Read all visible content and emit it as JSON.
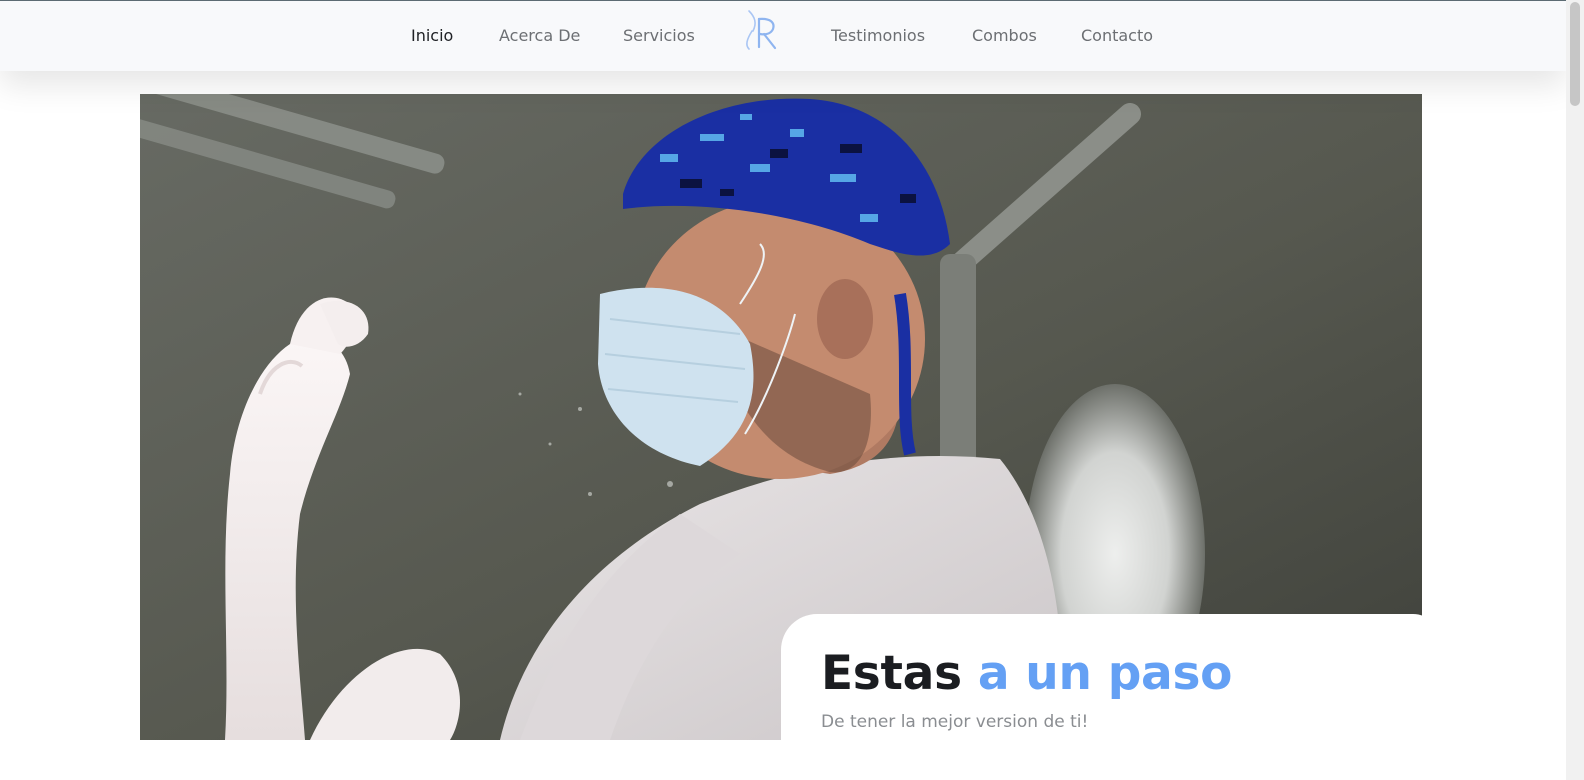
{
  "nav": {
    "links": [
      {
        "label": "Inicio",
        "active": true
      },
      {
        "label": "Acerca De",
        "active": false
      },
      {
        "label": "Servicios",
        "active": false
      },
      {
        "label": "Testimonios",
        "active": false
      },
      {
        "label": "Combos",
        "active": false
      },
      {
        "label": "Contacto",
        "active": false
      }
    ],
    "logo_icon": "letter-r-logo-icon"
  },
  "hero": {
    "heading_dark": "Estas",
    "heading_accent": "a un paso",
    "subheading": "De tener la mejor version de ti!"
  },
  "colors": {
    "accent": "#64a0f4",
    "nav_bg": "#f8f9fb",
    "heading_dark": "#1b1d21",
    "nav_text": "#6c6f73"
  }
}
